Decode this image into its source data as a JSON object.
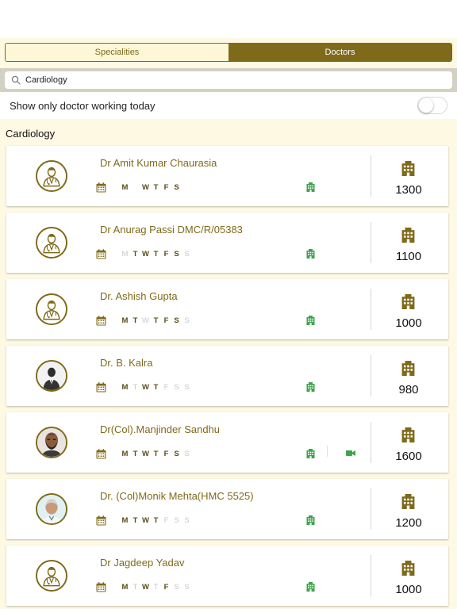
{
  "tabs": {
    "specialities": "Specialities",
    "doctors": "Doctors",
    "active": "Doctors"
  },
  "search": {
    "value": "Cardiology"
  },
  "filter": {
    "label": "Show only doctor working today",
    "enabled": false
  },
  "section": {
    "title": "Cardiology"
  },
  "day_letters": [
    "S",
    "M",
    "T",
    "W",
    "T",
    "F",
    "S",
    "S"
  ],
  "colors": {
    "brand": "#7f6a1a",
    "clinic_green": "#3fa34d",
    "day_on": "#5a4a18",
    "day_off": "#c7c7c7"
  },
  "doctors": [
    {
      "name": "Dr Amit Kumar Chaurasia",
      "fee": "1300",
      "avatar": "doctor-placeholder",
      "video": false,
      "days": [
        "",
        "on",
        "",
        "on",
        "on",
        "on",
        "on",
        ""
      ]
    },
    {
      "name": "Dr Anurag Passi DMC/R/05383",
      "fee": "1100",
      "avatar": "doctor-placeholder",
      "video": false,
      "days": [
        "",
        "off",
        "on",
        "on",
        "on",
        "on",
        "on",
        "off"
      ]
    },
    {
      "name": "Dr. Ashish Gupta",
      "fee": "1000",
      "avatar": "doctor-placeholder",
      "video": false,
      "days": [
        "",
        "on",
        "on",
        "off",
        "on",
        "on",
        "on",
        "off"
      ]
    },
    {
      "name": "Dr. B. Kalra",
      "fee": "980",
      "avatar": "doctor-suit-photo",
      "video": false,
      "days": [
        "",
        "on",
        "off",
        "on",
        "on",
        "off",
        "off",
        "off"
      ]
    },
    {
      "name": "Dr(Col).Manjinder Sandhu",
      "fee": "1600",
      "avatar": "doctor-bearded-photo",
      "video": true,
      "days": [
        "",
        "on",
        "on",
        "on",
        "on",
        "on",
        "on",
        "off"
      ]
    },
    {
      "name": "Dr. (Col)Monik Mehta(HMC 5525)",
      "fee": "1200",
      "avatar": "doctor-bald-photo",
      "video": false,
      "days": [
        "",
        "on",
        "on",
        "on",
        "on",
        "off",
        "off",
        "off"
      ]
    },
    {
      "name": "Dr Jagdeep Yadav",
      "fee": "1000",
      "avatar": "doctor-placeholder",
      "video": false,
      "days": [
        "",
        "on",
        "off",
        "on",
        "off",
        "on",
        "off",
        "off"
      ]
    }
  ]
}
